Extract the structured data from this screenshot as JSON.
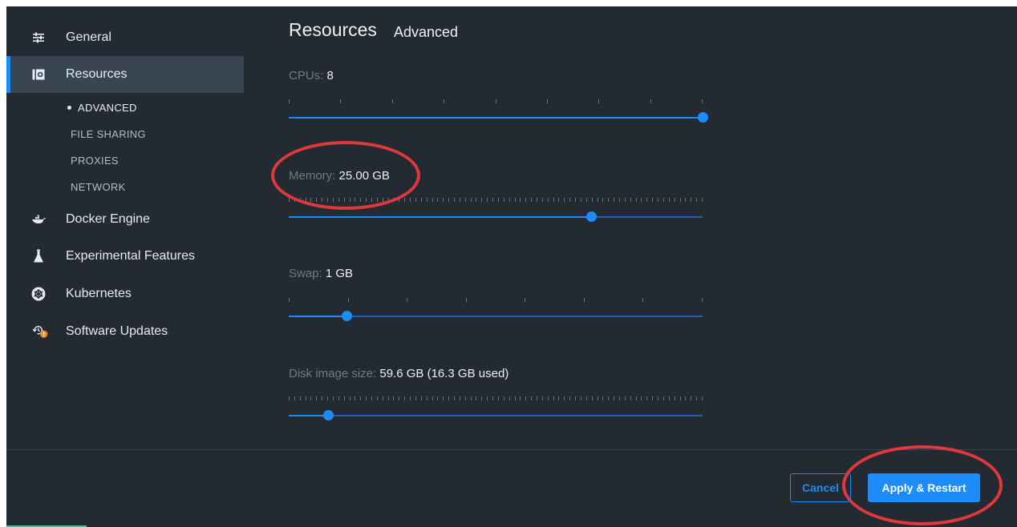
{
  "sidebar": {
    "items": [
      {
        "label": "General",
        "icon": "sliders-icon"
      },
      {
        "label": "Resources",
        "icon": "resources-icon",
        "active": true
      },
      {
        "label": "Docker Engine",
        "icon": "whale-icon"
      },
      {
        "label": "Experimental Features",
        "icon": "flask-icon"
      },
      {
        "label": "Kubernetes",
        "icon": "helm-icon"
      },
      {
        "label": "Software Updates",
        "icon": "update-icon"
      }
    ],
    "subitems": [
      "ADVANCED",
      "FILE SHARING",
      "PROXIES",
      "NETWORK"
    ]
  },
  "main": {
    "title": "Resources",
    "subtitle": "Advanced",
    "settings": [
      {
        "label": "CPUs:",
        "value": "8",
        "fraction": 1.0
      },
      {
        "label": "Memory:",
        "value": "25.00 GB",
        "fraction": 0.73
      },
      {
        "label": "Swap:",
        "value": "1 GB",
        "fraction": 0.14
      },
      {
        "label": "Disk image size:",
        "value": "59.6 GB (16.3 GB used)",
        "fraction": 0.095
      }
    ]
  },
  "footer": {
    "cancel_label": "Cancel",
    "apply_label": "Apply & Restart"
  },
  "colors": {
    "background": "#232a31",
    "accent": "#1d8cf8",
    "annotation": "#e0383c"
  }
}
